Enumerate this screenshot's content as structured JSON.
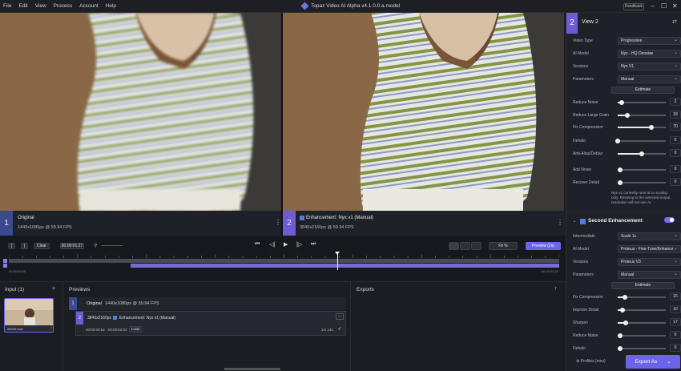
{
  "menu": [
    "File",
    "Edit",
    "View",
    "Process",
    "Account",
    "Help"
  ],
  "app_title": "Topaz Video AI Alpha  v4.1.0.0.a.model",
  "feedback_label": "Feedback",
  "viewers": [
    {
      "num": "1",
      "title": "Original",
      "sub": "1440x1080px @ 59.94 FPS"
    },
    {
      "num": "2",
      "title": "Enhancement: Nyx v1 (Manual)",
      "sub": "3840x2160px @ 59.94 FPS"
    }
  ],
  "panel": {
    "view_num": "2",
    "view_title": "View 2",
    "fields": [
      {
        "label": "Video Type",
        "value": "Progressive"
      },
      {
        "label": "AI Model",
        "value": "Nyx - HQ Denoise"
      },
      {
        "label": "Versions",
        "value": "Nyx V1"
      },
      {
        "label": "Parameters",
        "value": "Manual"
      }
    ],
    "estimate_label": "Estimate",
    "sliders": [
      {
        "label": "Reduce Noise",
        "value": "2",
        "frac": 0.08
      },
      {
        "label": "Reduce Large Grain",
        "value": "18",
        "frac": 0.2
      },
      {
        "label": "Fix Compression",
        "value": "70",
        "frac": 0.7
      },
      {
        "label": "Dehalo",
        "value": "0",
        "frac": 0
      },
      {
        "label": "Anti-Alias/Deblur",
        "value": "0",
        "frac": 0.5
      },
      {
        "label": "Add Noise",
        "value": "0",
        "frac": 0.05
      },
      {
        "label": "Recover Detail",
        "value": "0",
        "frac": 0.05
      }
    ],
    "note": "Nyx v1 currently runs at 1x scaling only. Resizing to the selected output resolution will not use AI.",
    "second_title": "Second Enhancement",
    "second_fields": [
      {
        "label": "Intermediate",
        "value": "Scale 1x"
      },
      {
        "label": "AI Model",
        "value": "Proteus - Fine-Tune/Enhance"
      },
      {
        "label": "Versions",
        "value": "Proteus V3"
      },
      {
        "label": "Parameters",
        "value": "Manual"
      }
    ],
    "second_estimate": "Estimate",
    "second_sliders": [
      {
        "label": "Fix Compression",
        "value": "15",
        "frac": 0.15
      },
      {
        "label": "Improve Detail",
        "value": "10",
        "frac": 0.1
      },
      {
        "label": "Sharpen",
        "value": "17",
        "frac": 0.17
      },
      {
        "label": "Reduce Noise",
        "value": "0",
        "frac": 0.05
      },
      {
        "label": "Dehalo",
        "value": "0",
        "frac": 0.05
      }
    ],
    "profiles": "Profiles (mov)",
    "export_label": "Export As"
  },
  "controls": {
    "in_label": "[",
    "out_label": "]",
    "clear_label": "Clear",
    "timecode": "00:00:01:27",
    "zoom_label": "Fit %",
    "preview_label": "Preview (2s)"
  },
  "timeline": {
    "start": "00:00:00:00",
    "end": "00:00:02:22"
  },
  "input": {
    "title": "Input (1)",
    "file": "00016.mov"
  },
  "previews": {
    "title": "Previews",
    "rows": [
      {
        "num": "1",
        "title": "Original",
        "sub": "1440x1080px @ 59.94 FPS"
      },
      {
        "num": "2",
        "res": "3840x2160px",
        "title": "Enhancement: Nyx v1 (Manual)",
        "range": "00:00:00:52 - 00:00:02:24",
        "loop": "Loop",
        "time": "1m 14s"
      }
    ]
  },
  "exports": {
    "title": "Exports"
  }
}
